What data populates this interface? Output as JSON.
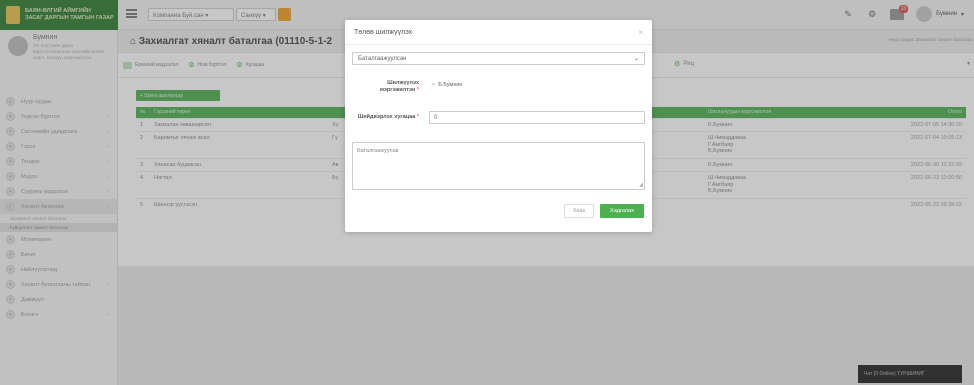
{
  "app": {
    "logo_text": [
      "БАЯН-ӨЛГИЙ АЙМГИЙН",
      "ЗАСАГ ДАРГЫН ТАМГЫН ГАЗАР"
    ]
  },
  "topbar": {
    "company_select": "Компаниа Буй.сан",
    "year_select": "Санхүү",
    "mail_badge": "13",
    "user_name": "Бумнин"
  },
  "sidebar": {
    "profile": {
      "name": "Бумнин",
      "info": [
        "ОХ Хэлтсийн дарга",
        "Бүртгэл хяналтын хэлтсийн албан",
        "хаагч, Санхүү, мэргэжилтэн"
      ]
    },
    "items": [
      {
        "label": "Нүүр хуудас",
        "arrow": ""
      },
      {
        "label": "Үндсэн бүртгэл",
        "arrow": "›"
      },
      {
        "label": "Системийн удирдлага",
        "arrow": "›"
      },
      {
        "label": "Гэрээ",
        "arrow": "›"
      },
      {
        "label": "Тендер",
        "arrow": "›"
      },
      {
        "label": "Мэдээ",
        "arrow": "›"
      },
      {
        "label": "Сууринь мэдээлэл",
        "arrow": "›"
      },
      {
        "label": "Хяналт баталгаа",
        "arrow": "›"
      }
    ],
    "subitems": [
      "Захиалгат хяналт баталгаа",
      "Гүйцэтгэлт хяналт баталгаа"
    ],
    "items2": [
      {
        "label": "Мониторинг",
        "arrow": ""
      },
      {
        "label": "Бичиг",
        "arrow": ""
      },
      {
        "label": "Нийлүүлэгчид",
        "arrow": ""
      },
      {
        "label": "Хяналт баталгааны тайлан",
        "arrow": "›"
      },
      {
        "label": "Дамжуул",
        "arrow": ""
      },
      {
        "label": "Бэлэгч",
        "arrow": "›"
      }
    ]
  },
  "main": {
    "title": "Захиалгат хяналт баталгаа (01110-5-1-2",
    "right_links": "Нүүр хуудас  Захиалгат хяналт баталгаа",
    "tabs": [
      "Ерөнхий мэдээлэл",
      "Ном бүртгэл",
      "Хугацаа"
    ],
    "tab_ris": "Риц",
    "add_button": "+ Шинэ шатлагаар",
    "columns": [
      "№",
      "Гэрээний төрөл",
      "",
      "",
      "Шатлалуудын мэргэжилтэн",
      "Огноо"
    ],
    "rows": [
      {
        "no": "1",
        "step": "Захиалан зөвшөөрсөн",
        "c3": "Хү",
        "c4": "",
        "reviewers": [
          "Б.Бумнин"
        ],
        "date": "2022-07-05 14:30:20"
      },
      {
        "no": "2",
        "step": "Баримтыг хянаж асан",
        "c3": "Гү",
        "c4": "",
        "reviewers": [
          "Ш.Чимэддаваа",
          "Г.Амгбаяр",
          "Б.Бумнин"
        ],
        "date": "2022-07-04 10:05:13"
      },
      {
        "no": "3",
        "step": "Хянасан буцаасан",
        "c3": "Ав",
        "c4": "",
        "reviewers": [
          "Б.Бумнин"
        ],
        "date": "2022-06-30 12:32:09"
      },
      {
        "no": "4",
        "step": "Нягтал",
        "c3": "Бү",
        "c4": "",
        "reviewers": [
          "Ш.Чимэддаваа",
          "Г.Амгбаяр",
          "Б.Бумнин"
        ],
        "date": "2022-06-23 13:00:50"
      },
      {
        "no": "5",
        "step": "Шинээр үүсгэсэн",
        "c3": "",
        "c4": "",
        "reviewers": [
          ""
        ],
        "date": "2022-05-23 09:39:22"
      }
    ]
  },
  "chat": {
    "label": "Чат (0 Online) ТУРШИНИГ"
  },
  "modal": {
    "title": "Төлөв шилжүүлэх",
    "close": "×",
    "status_value": "Баталгаажуулсан",
    "reviewer_label": "Шилжүүлэх мэргэжилтэн",
    "reviewer_required": "*",
    "reviewer_tag": "Б.Бумнин",
    "days_label": "Шийдвэрлэх хугацаа",
    "days_required": "*",
    "days_value": "0",
    "note_value": "Баталгаажуулав",
    "close_button": "Хаах",
    "save_button": "Хадгалах"
  }
}
